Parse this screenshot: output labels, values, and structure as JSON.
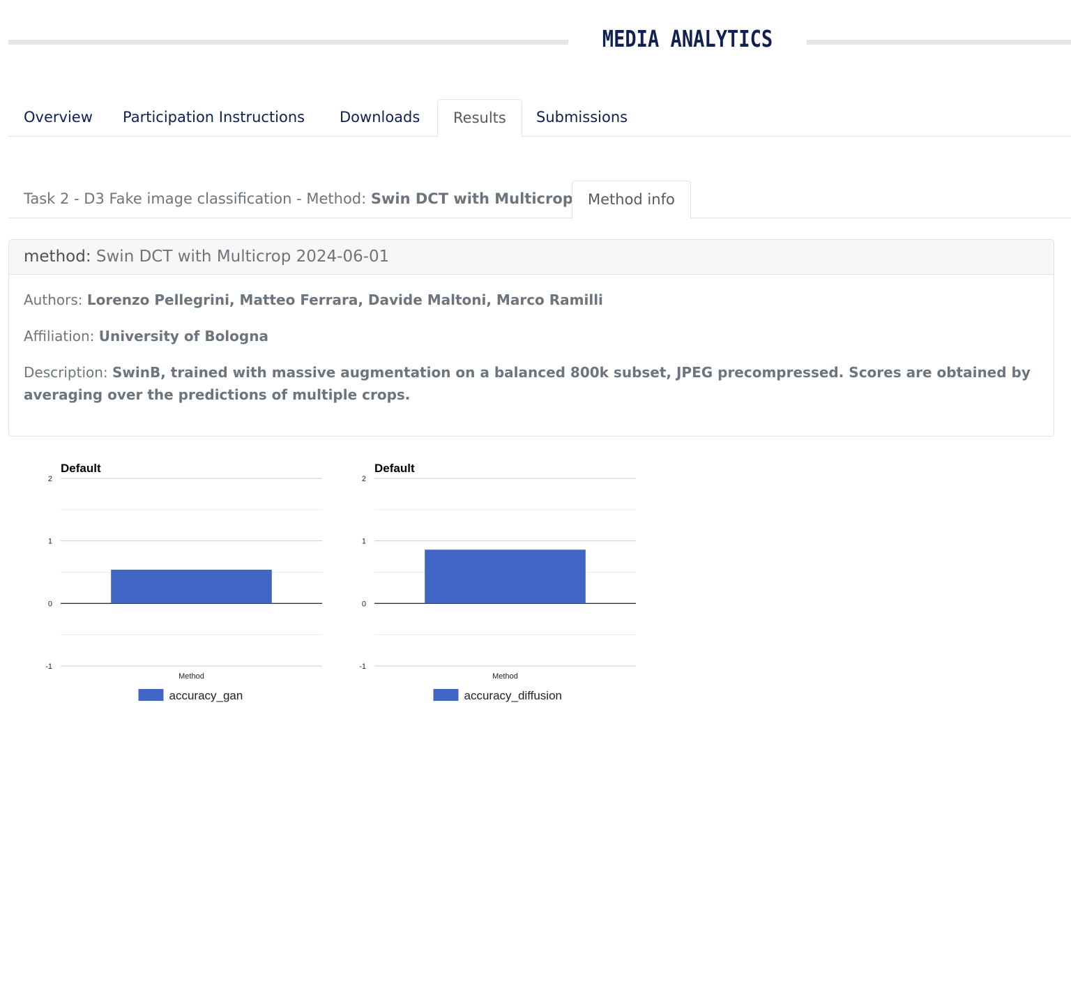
{
  "brand": {
    "title": "MEDIA ANALYTICS"
  },
  "tabs": [
    {
      "label": "Overview"
    },
    {
      "label": "Participation Instructions"
    },
    {
      "label": "Downloads"
    },
    {
      "label": "Results"
    },
    {
      "label": "Submissions"
    }
  ],
  "subtabs": {
    "task_prefix": "Task 2 - D3 Fake image classification - Method: ",
    "method_name": "Swin DCT with Multicrop",
    "method_info": "Method info"
  },
  "card": {
    "header_key": "method:",
    "header_method": "Swin DCT with Multicrop",
    "header_date": "2024-06-01",
    "authors_label": "Authors: ",
    "authors": "Lorenzo Pellegrini, Matteo Ferrara, Davide Maltoni, Marco Ramilli",
    "affiliation_label": "Affiliation: ",
    "affiliation": "University of Bologna",
    "description_label": "Description: ",
    "description": "SwinB, trained with massive augmentation on a balanced 800k subset, JPEG precompressed. Scores are obtained by averaging over the predictions of multiple crops."
  },
  "colors": {
    "bar": "#4065c4",
    "nav": "#0f2052"
  },
  "chart_data": [
    {
      "type": "bar",
      "title": "Default",
      "categories": [
        "Method"
      ],
      "series": [
        {
          "name": "accuracy_gan",
          "values": [
            0.54
          ]
        }
      ],
      "ylim": [
        -1,
        2
      ],
      "yticks": [
        "2",
        "1",
        "0",
        "-1"
      ],
      "legend": "bottom"
    },
    {
      "type": "bar",
      "title": "Default",
      "categories": [
        "Method"
      ],
      "series": [
        {
          "name": "accuracy_diffusion",
          "values": [
            0.86
          ]
        }
      ],
      "ylim": [
        -1,
        2
      ],
      "yticks": [
        "2",
        "1",
        "0",
        "-1"
      ],
      "legend": "bottom"
    }
  ]
}
